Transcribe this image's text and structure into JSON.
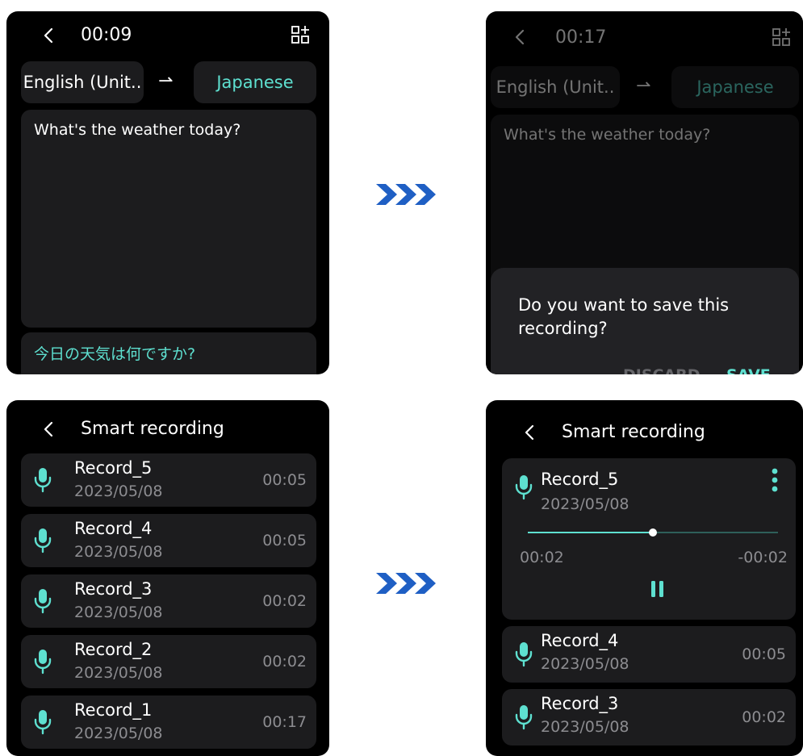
{
  "colors": {
    "accent": "#5ee0d0",
    "screen_bg": "#000000",
    "card_bg": "#1c1c1e",
    "secondary_text": "#8c8c90",
    "arrow_blue": "#1f5fc4"
  },
  "screen1": {
    "time": "00:09",
    "source_lang": "English (Unit..",
    "arrow": "⇀",
    "target_lang": "Japanese",
    "source_text": "What's the weather today?",
    "translated_text": "今日の天気は何ですか?"
  },
  "screen2": {
    "time": "00:17",
    "source_lang": "English (Unit..",
    "arrow": "⇀",
    "target_lang": "Japanese",
    "source_text": "What's the weather today?",
    "dialog": {
      "message": "Do you want to save this recording?",
      "discard_label": "DISCARD",
      "save_label": "SAVE"
    }
  },
  "screen3": {
    "title": "Smart recording",
    "records": [
      {
        "name": "Record_5",
        "date": "2023/05/08",
        "duration": "00:05"
      },
      {
        "name": "Record_4",
        "date": "2023/05/08",
        "duration": "00:05"
      },
      {
        "name": "Record_3",
        "date": "2023/05/08",
        "duration": "00:02"
      },
      {
        "name": "Record_2",
        "date": "2023/05/08",
        "duration": "00:02"
      },
      {
        "name": "Record_1",
        "date": "2023/05/08",
        "duration": "00:17"
      }
    ]
  },
  "screen4": {
    "title": "Smart recording",
    "player": {
      "name": "Record_5",
      "date": "2023/05/08",
      "elapsed": "00:02",
      "remaining": "-00:02",
      "progress": 0.5
    },
    "records": [
      {
        "name": "Record_4",
        "date": "2023/05/08",
        "duration": "00:05"
      },
      {
        "name": "Record_3",
        "date": "2023/05/08",
        "duration": "00:02"
      }
    ]
  }
}
